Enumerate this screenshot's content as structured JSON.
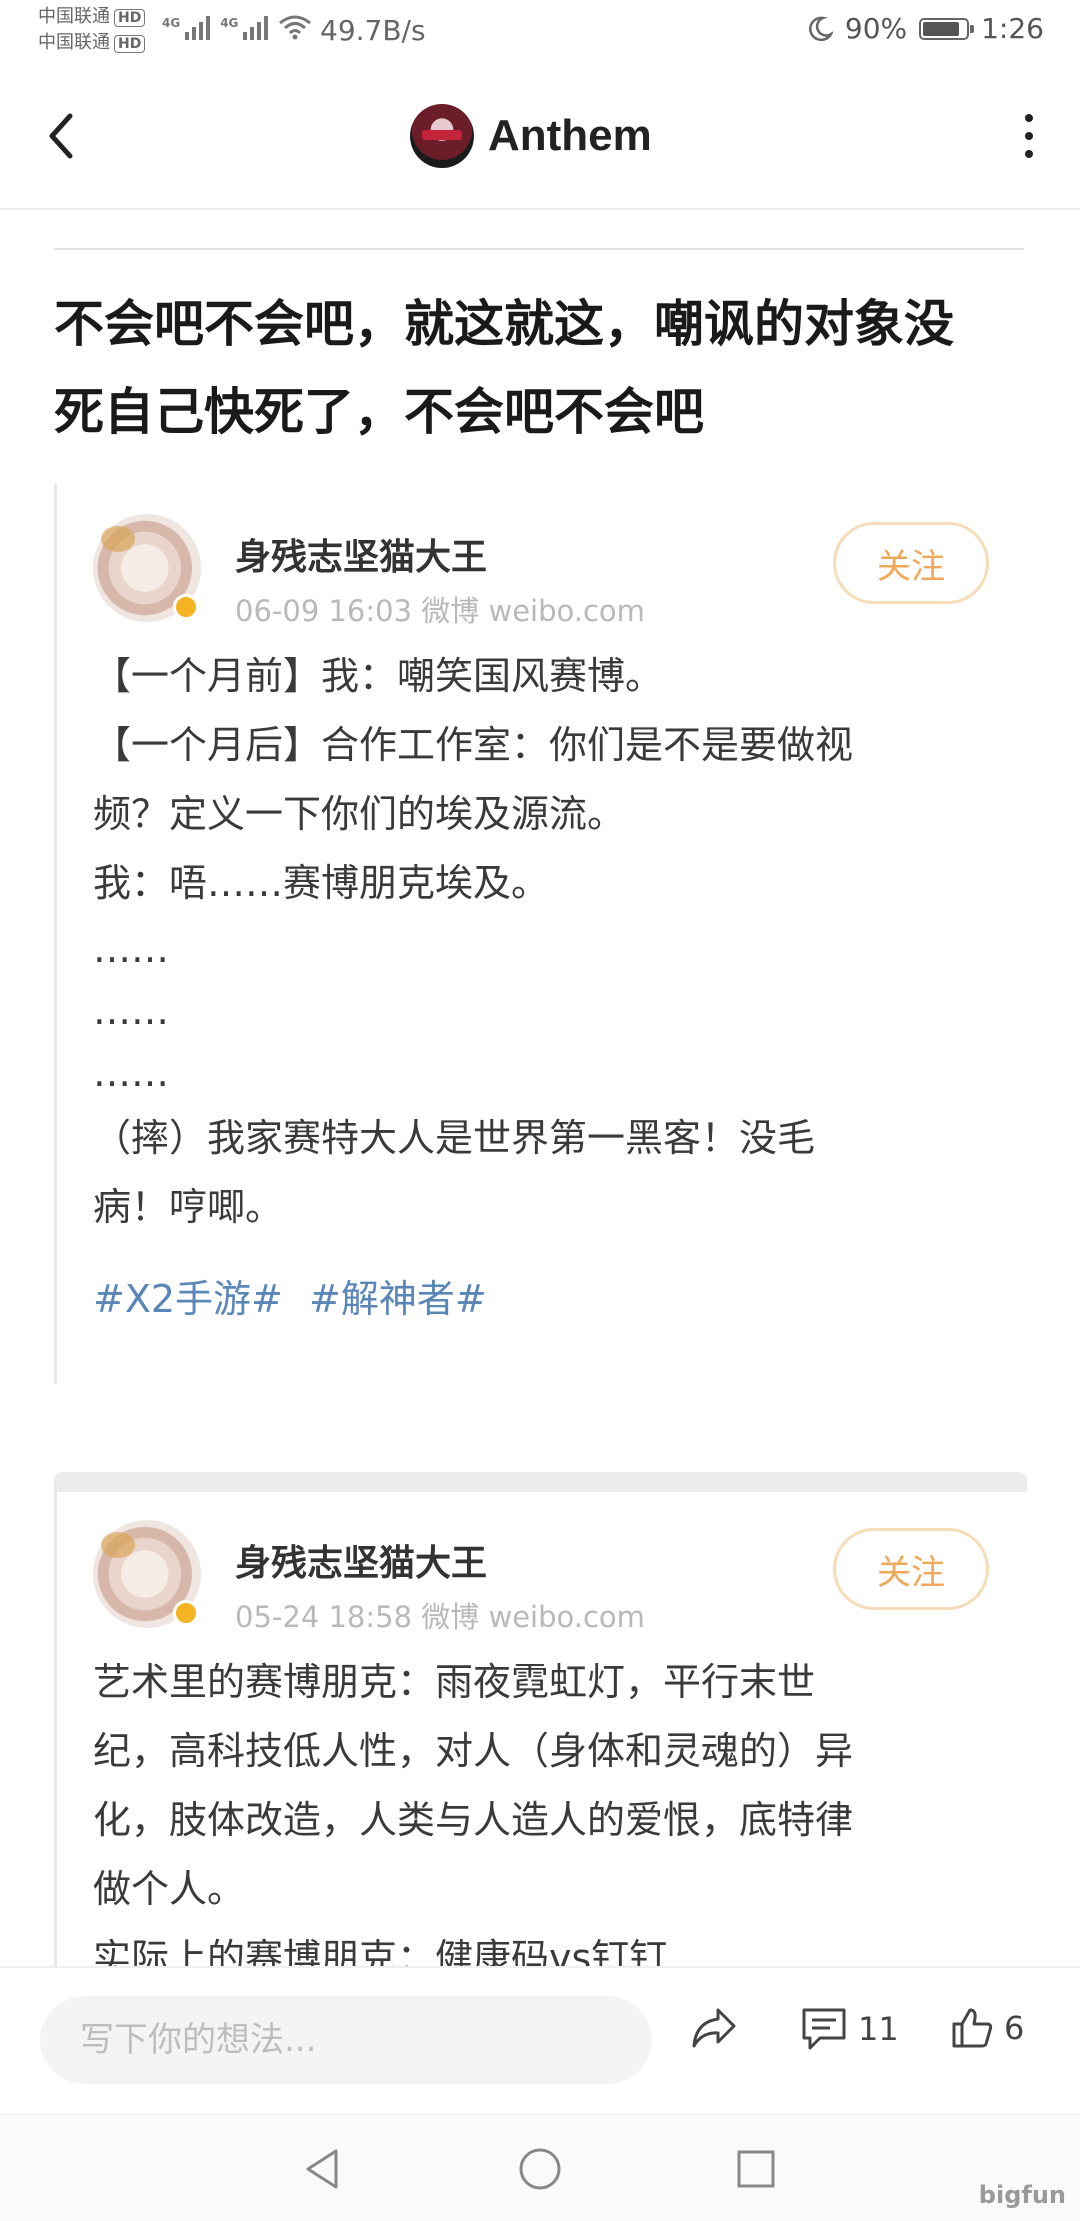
{
  "status": {
    "carrier_top": "中国联通",
    "carrier_bottom": "中国联通",
    "hd": "HD",
    "net1": "4G",
    "net2": "4G",
    "net_speed": "49.7B/s",
    "battery": "90%",
    "battery_level": 0.9,
    "time": "1:26"
  },
  "header": {
    "title": "Anthem"
  },
  "post": {
    "title_line1": "不会吧不会吧，就这就这，嘲讽的对象没",
    "title_line2": "死自己快死了，不会吧不会吧"
  },
  "cards": [
    {
      "name": "身残志坚猫大王",
      "meta": "06-09 16:03   微博 weibo.com",
      "follow": "关注",
      "lines": [
        "【一个月前】我：嘲笑国风赛博。",
        "【一个月后】合作工作室：你们是不是要做视",
        "频？定义一下你们的埃及源流。",
        "我：唔……赛博朋克埃及。",
        "……",
        "……",
        "……",
        "（摔）我家赛特大人是世界第一黑客！没毛",
        "病！哼唧。"
      ],
      "tags": [
        "#X2手游#",
        "#解神者#"
      ]
    },
    {
      "name": "身残志坚猫大王",
      "meta": "05-24 18:58   微博 weibo.com",
      "follow": "关注",
      "lines": [
        "艺术里的赛博朋克：雨夜霓虹灯，平行末世",
        "纪，高科技低人性，对人（身体和灵魂的）异",
        "化，肢体改造，人类与人造人的爱恨，底特律",
        "做个人。",
        "实际上的赛博朋克：健康码vs钉钉"
      ]
    }
  ],
  "actions": {
    "comment_placeholder": "写下你的想法...",
    "comment_count": "11",
    "like_count": "6"
  },
  "watermark": "bigfun"
}
